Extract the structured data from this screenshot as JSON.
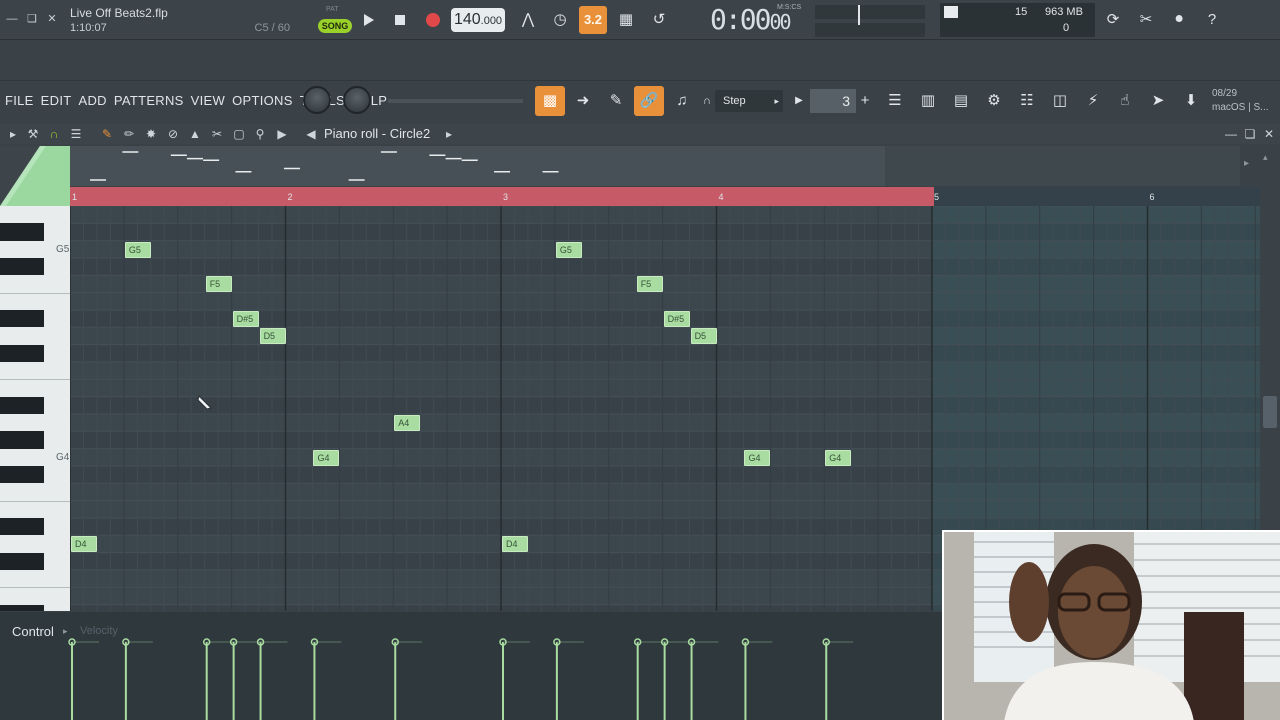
{
  "window": {
    "minimize_icon": "minimize-icon",
    "restore_icon": "restore-icon",
    "close_icon": "close-icon"
  },
  "project": {
    "filename": "Live Off Beats2.flp",
    "time": "1:10:07",
    "hint": "C5 / 60"
  },
  "transport": {
    "pat_label": "PAT",
    "song_label": "SONG",
    "tempo_whole": "140",
    "tempo_frac": ".000",
    "blend_label": "3.2",
    "time_main": "0:00",
    "time_small": "00",
    "time_units": "M:S:CS"
  },
  "monitor": {
    "cpu": "15",
    "memory": "963 MB",
    "polyphony": "0"
  },
  "menu": [
    "FILE",
    "EDIT",
    "ADD",
    "PATTERNS",
    "VIEW",
    "OPTIONS",
    "TOOLS",
    "HELP"
  ],
  "snap": {
    "label": "Step",
    "step_value": "3"
  },
  "news": {
    "date": "08/29",
    "text": "macOS | S..."
  },
  "piano_roll": {
    "title": "Piano roll - Circle2",
    "bars": [
      "1",
      "2",
      "3",
      "4",
      "5",
      "6"
    ],
    "key_labels": [
      "G5",
      "G4"
    ],
    "notes": [
      {
        "label": "G5",
        "pitch": "G5",
        "start": 0.25,
        "len": 0.125
      },
      {
        "label": "F5",
        "pitch": "F5",
        "start": 0.625,
        "len": 0.125
      },
      {
        "label": "D#5",
        "pitch": "D#5",
        "start": 0.75,
        "len": 0.125
      },
      {
        "label": "D5",
        "pitch": "D5",
        "start": 0.875,
        "len": 0.125
      },
      {
        "label": "G4",
        "pitch": "G4",
        "start": 1.125,
        "len": 0.125
      },
      {
        "label": "A4",
        "pitch": "A4",
        "start": 1.5,
        "len": 0.125
      },
      {
        "label": "D4",
        "pitch": "D4",
        "start": 0,
        "len": 0.125
      },
      {
        "label": "D4",
        "pitch": "D4",
        "start": 2.0,
        "len": 0.125
      },
      {
        "label": "G5",
        "pitch": "G5",
        "start": 2.25,
        "len": 0.125
      },
      {
        "label": "F5",
        "pitch": "F5",
        "start": 2.625,
        "len": 0.125
      },
      {
        "label": "D#5",
        "pitch": "D#5",
        "start": 2.75,
        "len": 0.125
      },
      {
        "label": "D5",
        "pitch": "D5",
        "start": 2.875,
        "len": 0.125
      },
      {
        "label": "G4",
        "pitch": "G4",
        "start": 3.125,
        "len": 0.125
      },
      {
        "label": "G4",
        "pitch": "G4",
        "start": 3.5,
        "len": 0.125
      }
    ]
  },
  "control": {
    "label": "Control",
    "target": "Velocity"
  },
  "colors": {
    "accent": "#e8903a",
    "song_green": "#9ad02a",
    "note_fill": "#a9dca0",
    "loop_region": "#c65a66",
    "record": "#e0484a"
  }
}
